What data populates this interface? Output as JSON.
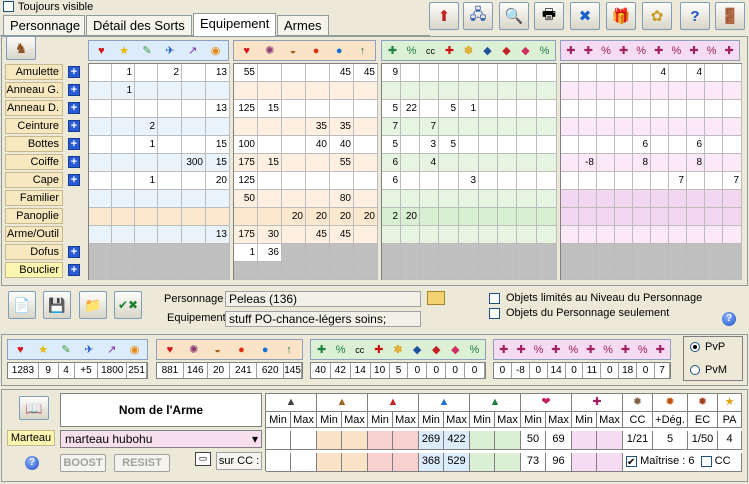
{
  "top": {
    "always_visible": "Toujours visible"
  },
  "tabs": [
    {
      "label": "Personnage"
    },
    {
      "label": "Détail des Sorts"
    },
    {
      "label": "Equipement"
    },
    {
      "label": "Armes"
    }
  ],
  "slots": [
    {
      "label": "Amulette"
    },
    {
      "label": "Anneau G."
    },
    {
      "label": "Anneau D."
    },
    {
      "label": "Ceinture"
    },
    {
      "label": "Bottes"
    },
    {
      "label": "Coiffe"
    },
    {
      "label": "Cape"
    },
    {
      "label": "Familier"
    },
    {
      "label": "Panoplie"
    },
    {
      "label": "Arme/Outil"
    },
    {
      "label": "Dofus"
    },
    {
      "label": "Bouclier"
    }
  ],
  "grid1_headers": [
    "♥",
    "★",
    "✎",
    "✈",
    "↗",
    "◉"
  ],
  "grid2_headers": [
    "♥",
    "✺",
    "◒",
    "●",
    "●",
    "↑"
  ],
  "grid3_headers": [
    "✚",
    "%",
    "cc",
    "✚",
    "✽",
    "◆",
    "◆",
    "◆",
    "%"
  ],
  "grid4_headers": [
    "✚",
    "✚",
    "%",
    "✚",
    "%",
    "✚",
    "%",
    "✚",
    "%",
    "✚"
  ],
  "grid1": [
    [
      "",
      "1",
      "",
      "2",
      "",
      "13"
    ],
    [
      "",
      "1",
      "",
      "",
      "",
      ""
    ],
    [
      "",
      "",
      "",
      "",
      "",
      "13"
    ],
    [
      "",
      "",
      "2",
      "",
      "",
      ""
    ],
    [
      "",
      "",
      "1",
      "",
      "",
      "15"
    ],
    [
      "",
      "",
      "",
      "",
      "300",
      "15"
    ],
    [
      "",
      "",
      "1",
      "",
      "",
      "20"
    ],
    [
      "",
      "",
      "",
      "",
      "",
      ""
    ],
    [
      "",
      "",
      "",
      "",
      "",
      ""
    ],
    [
      "",
      "",
      "",
      "",
      "",
      "13"
    ],
    [
      "",
      "",
      "",
      "",
      "",
      ""
    ],
    [
      "",
      "",
      "",
      "",
      "",
      ""
    ]
  ],
  "grid2": [
    [
      "55",
      "",
      "",
      "",
      "45",
      "45"
    ],
    [
      "",
      "",
      "",
      "",
      "",
      ""
    ],
    [
      "125",
      "15",
      "",
      "",
      "",
      ""
    ],
    [
      "",
      "",
      "",
      "35",
      "35",
      ""
    ],
    [
      "100",
      "",
      "",
      "40",
      "40",
      ""
    ],
    [
      "175",
      "15",
      "",
      "",
      "55",
      ""
    ],
    [
      "125",
      "",
      "",
      "",
      "",
      ""
    ],
    [
      "50",
      "",
      "",
      "",
      "80",
      ""
    ],
    [
      "",
      "",
      "20",
      "20",
      "20",
      "20"
    ],
    [
      "175",
      "30",
      "",
      "45",
      "45",
      ""
    ],
    [
      "1",
      "36",
      "",
      "",
      "",
      ""
    ],
    [
      "",
      "",
      "",
      "",
      "",
      ""
    ]
  ],
  "grid3": [
    [
      "9",
      "",
      "",
      "",
      "",
      "",
      "",
      "",
      ""
    ],
    [
      "",
      "",
      "",
      "",
      "",
      "",
      "",
      "",
      ""
    ],
    [
      "5",
      "22",
      "",
      "5",
      "1",
      "",
      "",
      "",
      ""
    ],
    [
      "7",
      "",
      "7",
      "",
      "",
      "",
      "",
      "",
      ""
    ],
    [
      "5",
      "",
      "3",
      "5",
      "",
      "",
      "",
      "",
      ""
    ],
    [
      "6",
      "",
      "4",
      "",
      "",
      "",
      "",
      "",
      ""
    ],
    [
      "6",
      "",
      "",
      "",
      "3",
      "",
      "",
      "",
      ""
    ],
    [
      "",
      "",
      "",
      "",
      "",
      "",
      "",
      "",
      ""
    ],
    [
      "2",
      "20",
      "",
      "",
      "",
      "",
      "",
      "",
      ""
    ],
    [
      "",
      "",
      "",
      "",
      "",
      "",
      "",
      "",
      ""
    ],
    [
      "",
      "",
      "",
      "",
      "",
      "",
      "",
      "",
      ""
    ],
    [
      "",
      "",
      "",
      "",
      "",
      "",
      "",
      "",
      ""
    ]
  ],
  "grid4": [
    [
      "",
      "",
      "",
      "",
      "",
      "4",
      "",
      "4",
      "",
      ""
    ],
    [
      "",
      "",
      "",
      "",
      "",
      "",
      "",
      "",
      "",
      ""
    ],
    [
      "",
      "",
      "",
      "",
      "",
      "",
      "",
      "",
      "",
      ""
    ],
    [
      "",
      "",
      "",
      "",
      "",
      "",
      "",
      "",
      "",
      ""
    ],
    [
      "",
      "",
      "",
      "",
      "6",
      "",
      "",
      "6",
      "",
      ""
    ],
    [
      "",
      "-8",
      "",
      "",
      "8",
      "",
      "",
      "8",
      "",
      ""
    ],
    [
      "",
      "",
      "",
      "",
      "",
      "",
      "7",
      "",
      "",
      "7"
    ],
    [
      "",
      "",
      "",
      "",
      "",
      "",
      "",
      "",
      "",
      ""
    ],
    [
      "",
      "",
      "",
      "",
      "",
      "",
      "",
      "",
      "",
      ""
    ],
    [
      "",
      "",
      "",
      "",
      "",
      "",
      "",
      "",
      "",
      ""
    ],
    [
      "",
      "",
      "",
      "",
      "",
      "",
      "",
      "",
      "",
      ""
    ],
    [
      "",
      "",
      "",
      "",
      "",
      "",
      "",
      "",
      "",
      ""
    ]
  ],
  "personnage": {
    "label": "Personnage",
    "value": "Peleas (136)"
  },
  "equipement": {
    "label": "Equipement",
    "value": "stuff PO-chance-légers soins;"
  },
  "options": {
    "limit_level": "Objets limités au Niveau du Personnage",
    "only_character": "Objets du Personnage seulement"
  },
  "summary": {
    "s1": [
      "1283",
      "9",
      "4",
      "+5",
      "1800",
      "251"
    ],
    "s2": [
      "881",
      "146",
      "20",
      "241",
      "620",
      "145"
    ],
    "s3": [
      "40",
      "42",
      "14",
      "10",
      "5",
      "0",
      "0",
      "0",
      "0"
    ],
    "s4": [
      "0",
      "-8",
      "0",
      "14",
      "0",
      "11",
      "0",
      "18",
      "0",
      "7"
    ]
  },
  "mode": {
    "pvp": "PvP",
    "pvm": "PvM"
  },
  "weapon": {
    "col_title": "Nom de l'Arme",
    "slot": "Marteau",
    "name": "marteau hubohu",
    "boost": "BOOST",
    "resist": "RESIST",
    "sur_cc": "sur CC :",
    "min": "Min",
    "max": "Max",
    "neutral": {
      "min": "269",
      "max": "422",
      "cc_min": "368",
      "cc_max": "529"
    },
    "heal": {
      "min": "50",
      "max": "69",
      "cc_min": "73",
      "cc_max": "96"
    },
    "cc_label": "CC",
    "deg_label": "+Dég.",
    "ec_label": "EC",
    "pa_label": "PA",
    "cc": "1/21",
    "deg": "5",
    "ec": "1/50",
    "pa": "4",
    "maitrise": "Maîtrise : 6",
    "cc_check": "CC"
  },
  "colors": {
    "pane1": "#dcecfa",
    "pane2": "#fbe3c8",
    "pane3": "#dcf0d6",
    "pane4": "#f6dcf2",
    "gray": "#c0c0c0",
    "accent": "#2a5bd6"
  }
}
